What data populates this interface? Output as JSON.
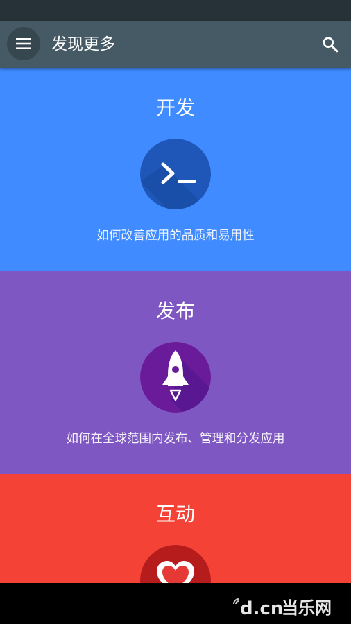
{
  "app_bar": {
    "title": "发现更多",
    "menu_icon": "menu-icon",
    "search_icon": "search-icon",
    "background": "#455a64"
  },
  "status_bar": {
    "background": "#263238"
  },
  "sections": [
    {
      "title": "开发",
      "description": "如何改善应用的品质和易用性",
      "icon": "terminal-icon",
      "color": "#3f8bff"
    },
    {
      "title": "发布",
      "description": "如何在全球范围内发布、管理和分发应用",
      "icon": "rocket-icon",
      "color": "#7e57c2"
    },
    {
      "title": "互动",
      "description": "",
      "icon": "heart-icon",
      "color": "#f44336"
    }
  ],
  "watermark": {
    "text": "d.cn当乐网"
  }
}
